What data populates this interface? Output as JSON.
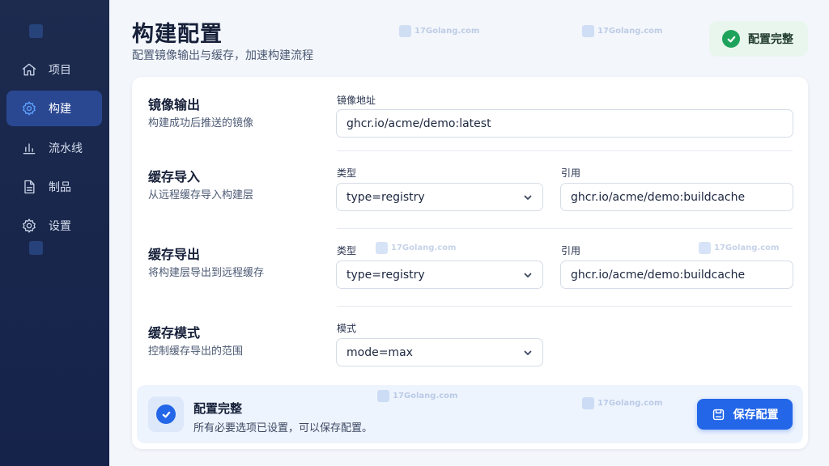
{
  "sidebar": {
    "items": [
      {
        "label": "项目",
        "icon": "home-icon",
        "active": false
      },
      {
        "label": "构建",
        "icon": "gear-icon",
        "active": true
      },
      {
        "label": "流水线",
        "icon": "bar-chart-icon",
        "active": false
      },
      {
        "label": "制品",
        "icon": "document-icon",
        "active": false
      },
      {
        "label": "设置",
        "icon": "settings-icon",
        "active": false
      }
    ]
  },
  "header": {
    "title": "构建配置",
    "subtitle": "配置镜像输出与缓存，加速构建流程",
    "status": "配置完整"
  },
  "sections": {
    "image_output": {
      "title": "镜像输出",
      "desc": "构建成功后推送的镜像",
      "label": "镜像地址",
      "value": "ghcr.io/acme/demo:latest"
    },
    "cache_import": {
      "title": "缓存导入",
      "desc": "从远程缓存导入构建层",
      "type_label": "类型",
      "type_value": "type=registry",
      "ref_label": "引用",
      "ref_value": "ghcr.io/acme/demo:buildcache"
    },
    "cache_export": {
      "title": "缓存导出",
      "desc": "将构建层导出到远程缓存",
      "type_label": "类型",
      "type_value": "type=registry",
      "ref_label": "引用",
      "ref_value": "ghcr.io/acme/demo:buildcache"
    },
    "cache_mode": {
      "title": "缓存模式",
      "desc": "控制缓存导出的范围",
      "label": "模式",
      "value": "mode=max"
    }
  },
  "banner": {
    "title": "配置完整",
    "desc": "所有必要选项已设置，可以保存配置。",
    "save_label": "保存配置"
  },
  "watermark": {
    "text": "17Golang.com"
  },
  "colors": {
    "sidebar_bg": "#1d2b4f",
    "accent": "#2366e8",
    "success": "#1fa35c"
  }
}
